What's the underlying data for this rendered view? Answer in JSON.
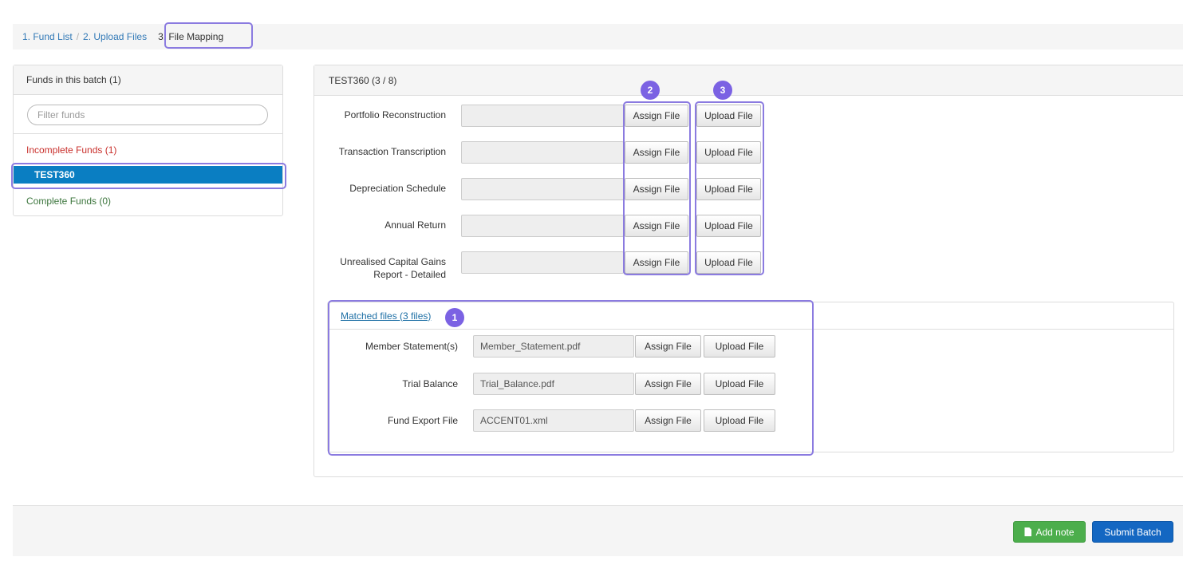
{
  "breadcrumb": {
    "step1": "1. Fund List",
    "separator": "/",
    "step2": "2. Upload Files",
    "step3": "3. File Mapping"
  },
  "funds_panel": {
    "title": "Funds in this batch (1)",
    "filter_placeholder": "Filter funds",
    "incomplete_label": "Incomplete Funds (1)",
    "selected_fund": "TEST360",
    "complete_label": "Complete Funds (0)"
  },
  "mapping_panel": {
    "title": "TEST360 (3 / 8)",
    "rows": [
      {
        "label": "Portfolio Reconstruction",
        "value": "",
        "assign": "Assign File",
        "upload": "Upload File"
      },
      {
        "label": "Transaction Transcription",
        "value": "",
        "assign": "Assign File",
        "upload": "Upload File"
      },
      {
        "label": "Depreciation Schedule",
        "value": "",
        "assign": "Assign File",
        "upload": "Upload File"
      },
      {
        "label": "Annual Return",
        "value": "",
        "assign": "Assign File",
        "upload": "Upload File"
      },
      {
        "label_line1": "Unrealised Capital Gains",
        "label_line2": "Report - Detailed",
        "value": "",
        "assign": "Assign File",
        "upload": "Upload File"
      }
    ]
  },
  "matched": {
    "link": "Matched files (3 files)",
    "rows": [
      {
        "label": "Member Statement(s)",
        "value": "Member_Statement.pdf",
        "assign": "Assign File",
        "upload": "Upload File"
      },
      {
        "label": "Trial Balance",
        "value": "Trial_Balance.pdf",
        "assign": "Assign File",
        "upload": "Upload File"
      },
      {
        "label": "Fund Export File",
        "value": "ACCENT01.xml",
        "assign": "Assign File",
        "upload": "Upload File"
      }
    ]
  },
  "annotations": {
    "badge1": "1",
    "badge2": "2",
    "badge3": "3"
  },
  "footer": {
    "add_note": "Add note",
    "submit": "Submit Batch"
  },
  "colors": {
    "accent": "#7b62e3",
    "selected": "#0a7ec2",
    "incomplete": "#c9302c",
    "complete": "#3c763d",
    "add_note": "#4cae4c",
    "submit": "#1467c2"
  }
}
